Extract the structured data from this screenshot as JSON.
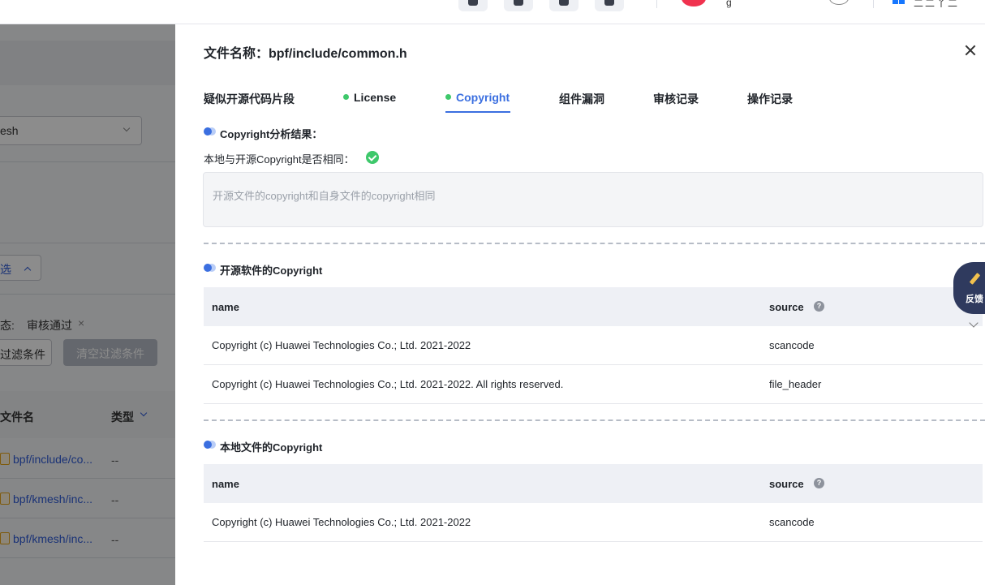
{
  "topbar": {
    "user": "g",
    "logo_text": "二二丫二"
  },
  "background": {
    "select_value": "esh",
    "filter_toggle": "选",
    "status_label": "态:",
    "status_value": "审核通过",
    "status_close": "×",
    "filter_btn": "过滤条件",
    "clear_btn": "清空过滤条件",
    "col_filename": "文件名",
    "col_type": "类型",
    "rows": [
      {
        "name": "bpf/include/co...",
        "type": "--"
      },
      {
        "name": "bpf/kmesh/inc...",
        "type": "--"
      },
      {
        "name": "bpf/kmesh/inc...",
        "type": "--"
      }
    ]
  },
  "drawer": {
    "title": "文件名称：bpf/include/common.h",
    "tabs": [
      {
        "label": "疑似开源代码片段",
        "dot": false
      },
      {
        "label": "License",
        "dot": true
      },
      {
        "label": "Copyright",
        "dot": true,
        "active": true
      },
      {
        "label": "组件漏洞",
        "dot": false
      },
      {
        "label": "审核记录",
        "dot": false
      },
      {
        "label": "操作记录",
        "dot": false
      }
    ],
    "analysis": {
      "title": "Copyright分析结果：",
      "same_label": "本地与开源Copyright是否相同：",
      "result_text": "开源文件的copyright和自身文件的copyright相同"
    },
    "opensource": {
      "title": "开源软件的Copyright",
      "col_name": "name",
      "col_source": "source",
      "rows": [
        {
          "name": "Copyright (c) Huawei Technologies Co.; Ltd. 2021-2022",
          "source": "scancode"
        },
        {
          "name": "Copyright (c) Huawei Technologies Co.; Ltd. 2021-2022. All rights reserved.",
          "source": "file_header"
        }
      ]
    },
    "local": {
      "title": "本地文件的Copyright",
      "col_name": "name",
      "col_source": "source",
      "rows": [
        {
          "name": "Copyright (c) Huawei Technologies Co.; Ltd. 2021-2022",
          "source": "scancode"
        }
      ]
    }
  },
  "feedback": {
    "label": "反馈"
  },
  "colors": {
    "accent": "#3b6fe0",
    "success": "#3ec86b",
    "mask": "rgba(0,0,0,0.45)"
  }
}
